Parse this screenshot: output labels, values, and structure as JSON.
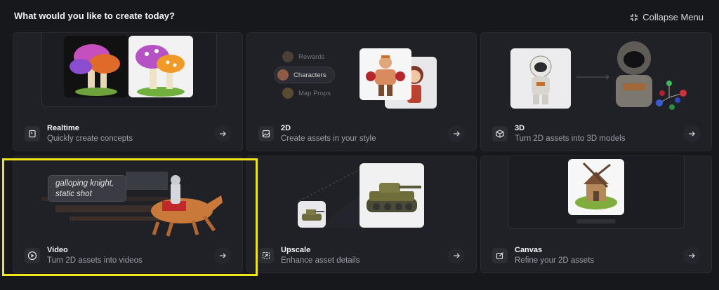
{
  "header": {
    "title": "What would you like to create today?",
    "collapse_label": "Collapse Menu"
  },
  "cards": {
    "realtime": {
      "title": "Realtime",
      "desc": "Quickly create concepts",
      "icon": "realtime-icon"
    },
    "2d": {
      "title": "2D",
      "desc": "Create assets in your style",
      "icon": "image-icon",
      "preview_tags": [
        "Rewards",
        "Characters",
        "Map Props"
      ]
    },
    "3d": {
      "title": "3D",
      "desc": "Turn 2D assets into 3D models",
      "icon": "cube-icon"
    },
    "video": {
      "title": "Video",
      "desc": "Turn 2D assets into videos",
      "icon": "play-icon",
      "prompt_line1": "galloping knight,",
      "prompt_line2": "static shot"
    },
    "upscale": {
      "title": "Upscale",
      "desc": "Enhance asset details",
      "icon": "upscale-icon"
    },
    "canvas": {
      "title": "Canvas",
      "desc": "Refine your 2D assets",
      "icon": "edit-icon"
    }
  },
  "colors": {
    "background": "#17181c",
    "card": "#202127",
    "highlight": "#f2e51b"
  }
}
